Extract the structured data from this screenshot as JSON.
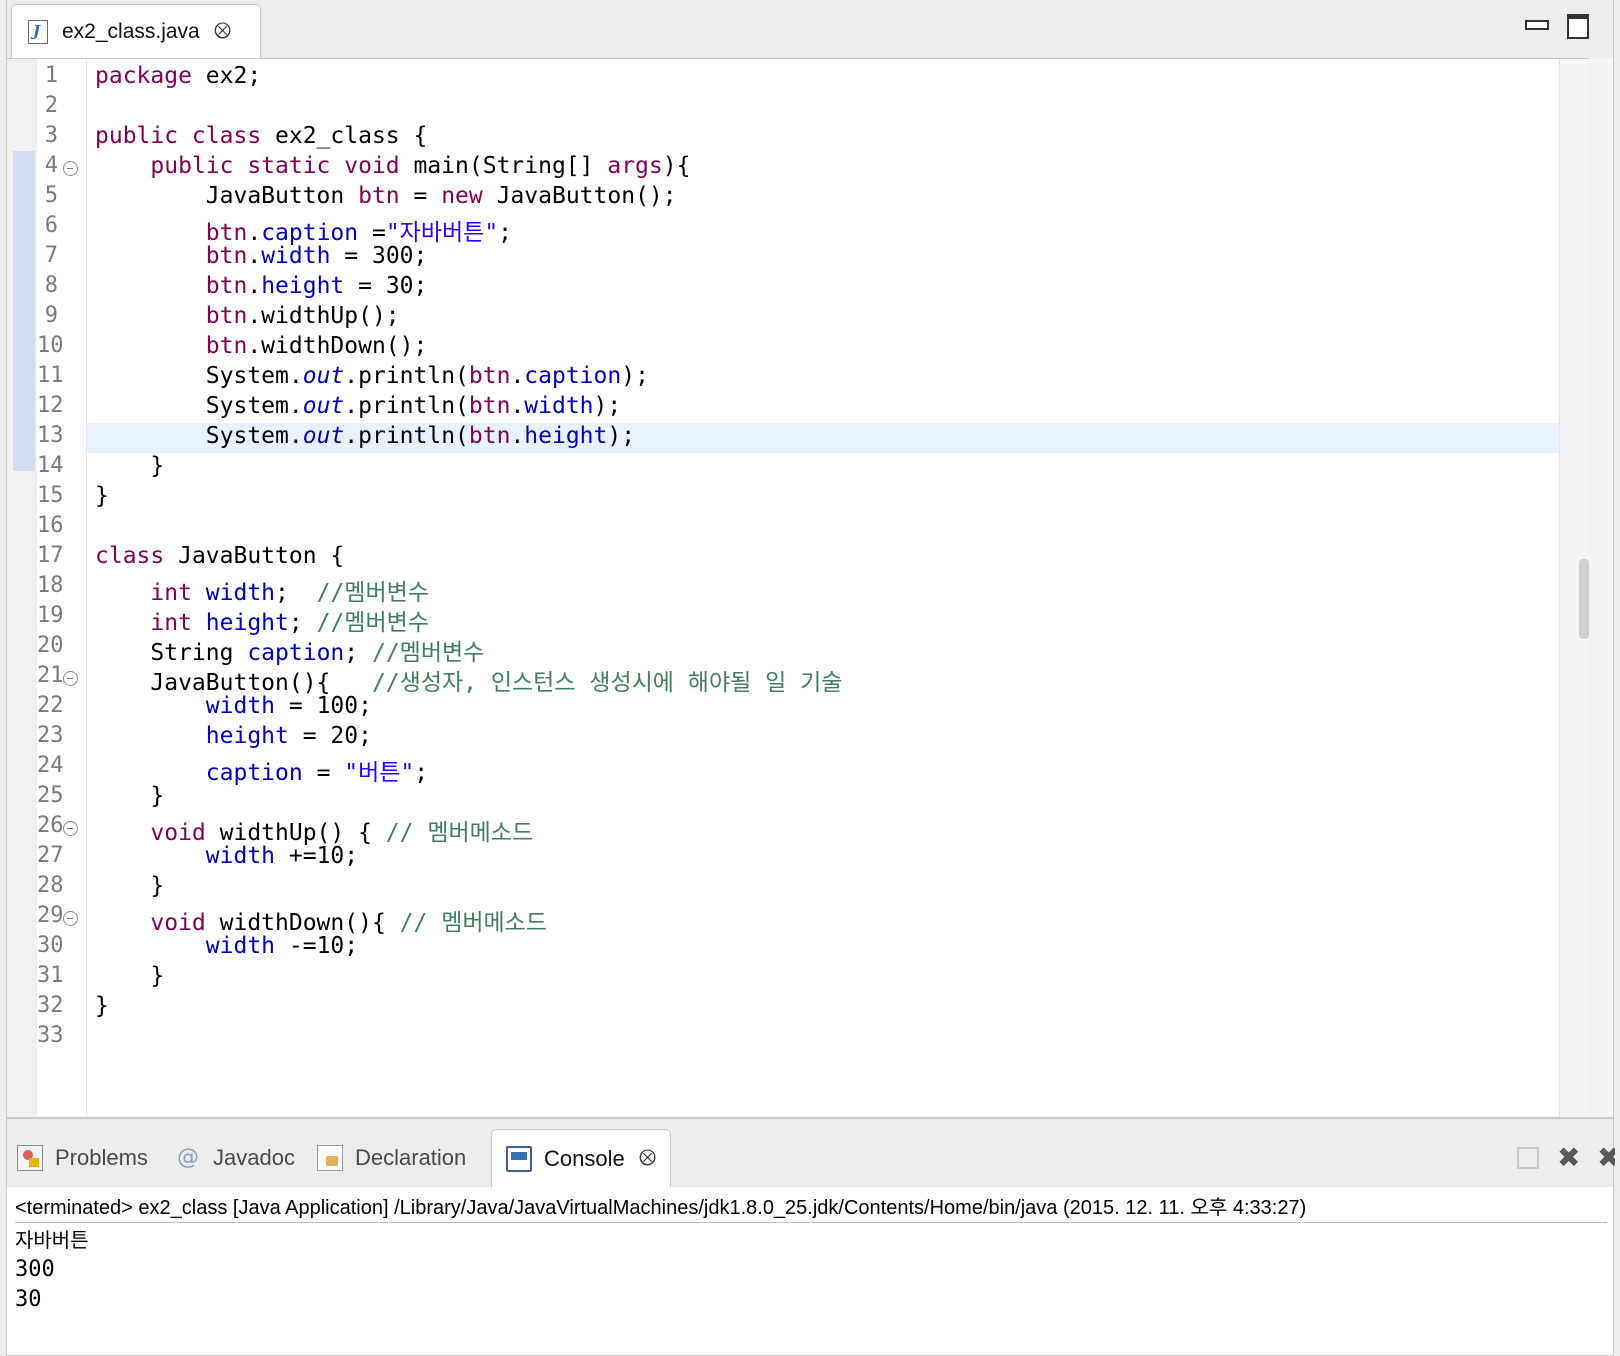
{
  "editor": {
    "tab": {
      "file_name": "ex2_class.java",
      "icon": "java-file-icon",
      "close_icon": "close-icon"
    },
    "line_numbers": [
      "1",
      "2",
      "3",
      "4",
      "5",
      "6",
      "7",
      "8",
      "9",
      "10",
      "11",
      "12",
      "13",
      "14",
      "15",
      "16",
      "17",
      "18",
      "19",
      "20",
      "21",
      "22",
      "23",
      "24",
      "25",
      "26",
      "27",
      "28",
      "29",
      "30",
      "31",
      "32",
      "33"
    ],
    "fold_lines": [
      4,
      21,
      26,
      29
    ],
    "current_line": 13,
    "lines": [
      [
        [
          "kw",
          "package"
        ],
        [
          "t",
          " ex2;"
        ]
      ],
      [],
      [
        [
          "kw",
          "public class"
        ],
        [
          "t",
          " ex2_class {"
        ]
      ],
      [
        [
          "t",
          "    "
        ],
        [
          "kw",
          "public static void"
        ],
        [
          "t",
          " main(String[] "
        ],
        [
          "kw",
          "args"
        ],
        [
          "t",
          "){"
        ]
      ],
      [
        [
          "t",
          "        JavaButton "
        ],
        [
          "kw",
          "btn"
        ],
        [
          "t",
          " = "
        ],
        [
          "kw",
          "new"
        ],
        [
          "t",
          " JavaButton();"
        ]
      ],
      [
        [
          "t",
          "        "
        ],
        [
          "kw",
          "btn"
        ],
        [
          "t",
          "."
        ],
        [
          "fld",
          "caption"
        ],
        [
          "t",
          " ="
        ],
        [
          "str",
          "\"자바버튼\""
        ],
        [
          "t",
          ";"
        ]
      ],
      [
        [
          "t",
          "        "
        ],
        [
          "kw",
          "btn"
        ],
        [
          "t",
          "."
        ],
        [
          "fld",
          "width"
        ],
        [
          "t",
          " = 300;"
        ]
      ],
      [
        [
          "t",
          "        "
        ],
        [
          "kw",
          "btn"
        ],
        [
          "t",
          "."
        ],
        [
          "fld",
          "height"
        ],
        [
          "t",
          " = 30;"
        ]
      ],
      [
        [
          "t",
          "        "
        ],
        [
          "kw",
          "btn"
        ],
        [
          "t",
          ".widthUp();"
        ]
      ],
      [
        [
          "t",
          "        "
        ],
        [
          "kw",
          "btn"
        ],
        [
          "t",
          ".widthDown();"
        ]
      ],
      [
        [
          "t",
          "        System."
        ],
        [
          "stat",
          "out"
        ],
        [
          "t",
          ".println("
        ],
        [
          "kw",
          "btn"
        ],
        [
          "t",
          "."
        ],
        [
          "fld",
          "caption"
        ],
        [
          "t",
          ");"
        ]
      ],
      [
        [
          "t",
          "        System."
        ],
        [
          "stat",
          "out"
        ],
        [
          "t",
          ".println("
        ],
        [
          "kw",
          "btn"
        ],
        [
          "t",
          "."
        ],
        [
          "fld",
          "width"
        ],
        [
          "t",
          ");"
        ]
      ],
      [
        [
          "t",
          "        System."
        ],
        [
          "stat",
          "out"
        ],
        [
          "t",
          ".println("
        ],
        [
          "kw",
          "btn"
        ],
        [
          "t",
          "."
        ],
        [
          "fld",
          "height"
        ],
        [
          "t",
          ");"
        ]
      ],
      [
        [
          "t",
          "    }"
        ]
      ],
      [
        [
          "t",
          "}"
        ]
      ],
      [],
      [
        [
          "kw",
          "class"
        ],
        [
          "t",
          " JavaButton {"
        ]
      ],
      [
        [
          "t",
          "    "
        ],
        [
          "kw",
          "int"
        ],
        [
          "t",
          " "
        ],
        [
          "fld",
          "width"
        ],
        [
          "t",
          ";  "
        ],
        [
          "cmt",
          "//멤버변수"
        ]
      ],
      [
        [
          "t",
          "    "
        ],
        [
          "kw",
          "int"
        ],
        [
          "t",
          " "
        ],
        [
          "fld",
          "height"
        ],
        [
          "t",
          "; "
        ],
        [
          "cmt",
          "//멤버변수"
        ]
      ],
      [
        [
          "t",
          "    String "
        ],
        [
          "fld",
          "caption"
        ],
        [
          "t",
          "; "
        ],
        [
          "cmt",
          "//멤버변수"
        ]
      ],
      [
        [
          "t",
          "    JavaButton(){   "
        ],
        [
          "cmt",
          "//생성자, 인스턴스 생성시에 해야될 일 기술"
        ]
      ],
      [
        [
          "t",
          "        "
        ],
        [
          "fld",
          "width"
        ],
        [
          "t",
          " = 100;"
        ]
      ],
      [
        [
          "t",
          "        "
        ],
        [
          "fld",
          "height"
        ],
        [
          "t",
          " = 20;"
        ]
      ],
      [
        [
          "t",
          "        "
        ],
        [
          "fld",
          "caption"
        ],
        [
          "t",
          " = "
        ],
        [
          "str",
          "\"버튼\""
        ],
        [
          "t",
          ";"
        ]
      ],
      [
        [
          "t",
          "    }"
        ]
      ],
      [
        [
          "t",
          "    "
        ],
        [
          "kw",
          "void"
        ],
        [
          "t",
          " widthUp() { "
        ],
        [
          "cmt",
          "// 멤버메소드"
        ]
      ],
      [
        [
          "t",
          "        "
        ],
        [
          "fld",
          "width"
        ],
        [
          "t",
          " +=10;"
        ]
      ],
      [
        [
          "t",
          "    }"
        ]
      ],
      [
        [
          "t",
          "    "
        ],
        [
          "kw",
          "void"
        ],
        [
          "t",
          " widthDown(){ "
        ],
        [
          "cmt",
          "// 멤버메소드"
        ]
      ],
      [
        [
          "t",
          "        "
        ],
        [
          "fld",
          "width"
        ],
        [
          "t",
          " -=10;"
        ]
      ],
      [
        [
          "t",
          "    }"
        ]
      ],
      [
        [
          "t",
          "}"
        ]
      ],
      []
    ],
    "colors": {
      "keyword": "#7f0055",
      "field": "#0000c0",
      "string": "#2a00ff",
      "comment": "#3f7f5f",
      "current_line": "#e8f2fe"
    }
  },
  "bottom_panel": {
    "tabs": [
      {
        "id": "problems",
        "label": "Problems",
        "icon": "problems-icon"
      },
      {
        "id": "javadoc",
        "label": "Javadoc",
        "icon": "at-sign-icon"
      },
      {
        "id": "declaration",
        "label": "Declaration",
        "icon": "declaration-icon"
      },
      {
        "id": "console",
        "label": "Console",
        "icon": "console-icon",
        "active": true
      }
    ],
    "console": {
      "header": "<terminated> ex2_class [Java Application] /Library/Java/JavaVirtualMachines/jdk1.8.0_25.jdk/Contents/Home/bin/java (2015. 12. 11. 오후 4:33:27)",
      "output": [
        "자바버튼",
        "300",
        "30"
      ]
    }
  }
}
